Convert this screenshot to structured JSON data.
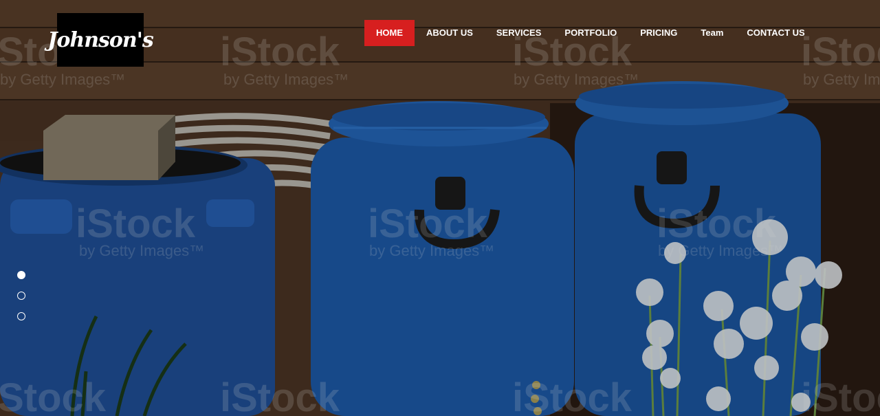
{
  "brand": {
    "logo_text": "Johnson's"
  },
  "nav": {
    "items": [
      {
        "label": "HOME",
        "active": true
      },
      {
        "label": "ABOUT US"
      },
      {
        "label": "SERVICES"
      },
      {
        "label": "PORTFOLIO"
      },
      {
        "label": "PRICING"
      },
      {
        "label": "Team"
      },
      {
        "label": "CONTACT US"
      }
    ],
    "active_color": "#d71f1f"
  },
  "slider": {
    "slide_count": 3,
    "active_index": 0
  },
  "hero_image": {
    "watermark_main": "iStock",
    "watermark_sub": "by Getty Images™"
  }
}
